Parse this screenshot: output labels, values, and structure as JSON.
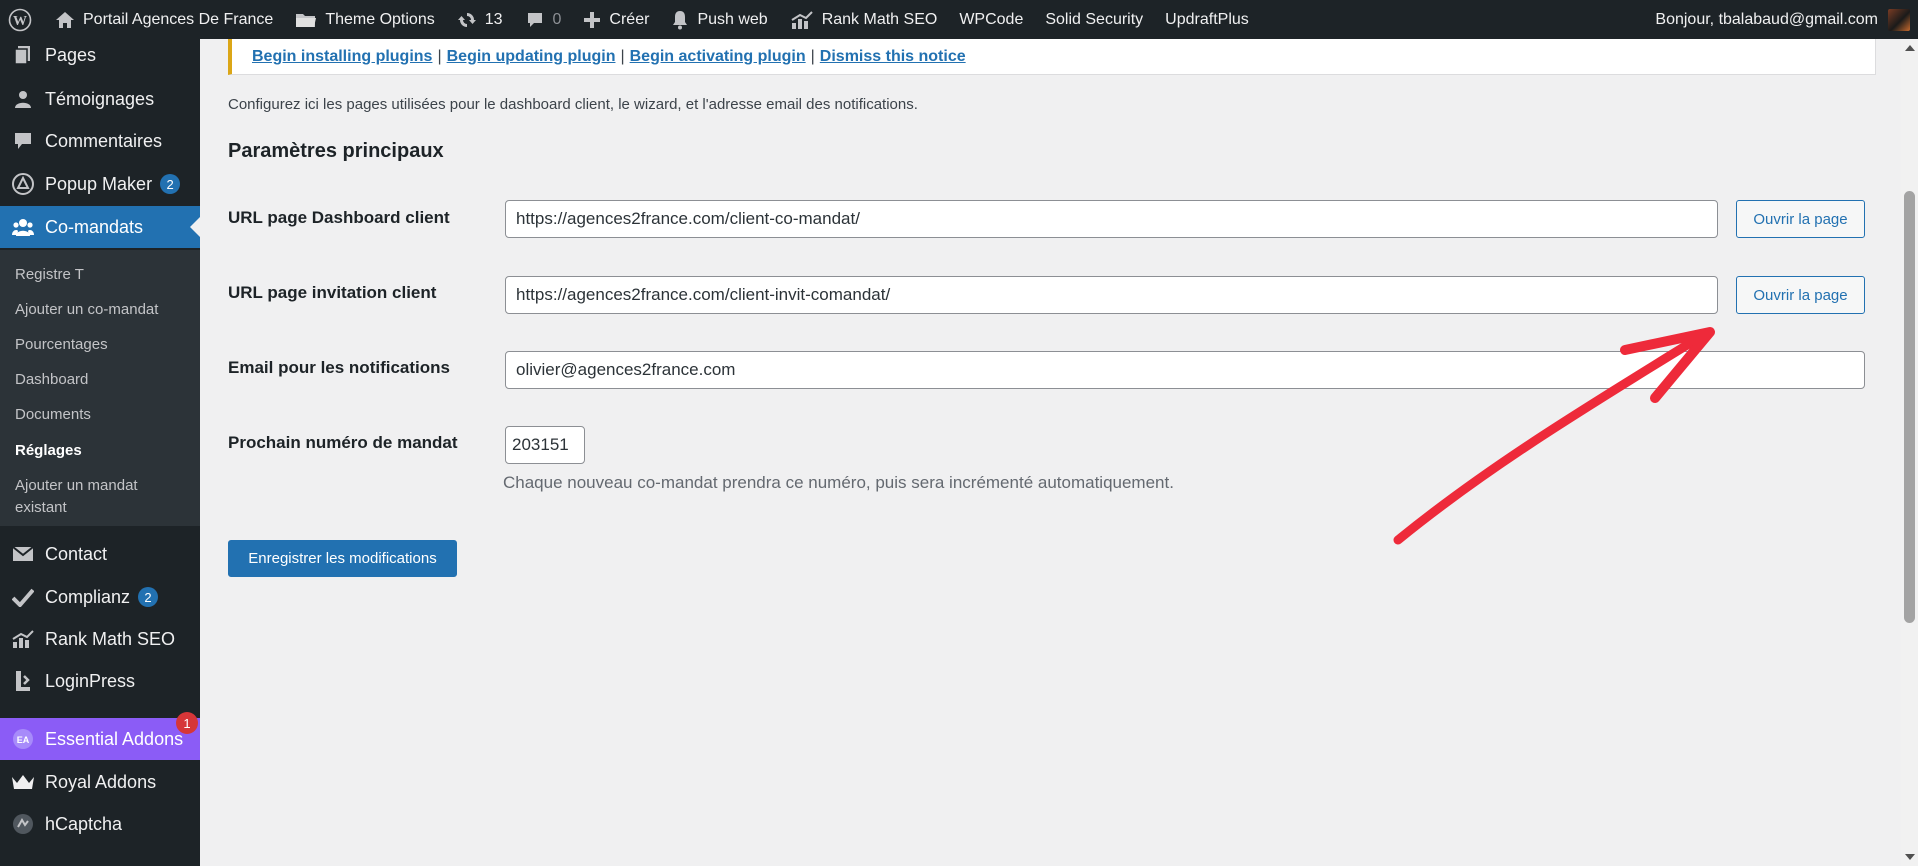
{
  "admin_bar": {
    "site_name": "Portail Agences De France",
    "theme_options": "Theme Options",
    "updates_count": "13",
    "comments_count": "0",
    "create": "Créer",
    "push_web": "Push web",
    "rank_math": "Rank Math SEO",
    "wpcode": "WPCode",
    "solid_security": "Solid Security",
    "updraftplus": "UpdraftPlus",
    "greeting": "Bonjour, tbalabaud@gmail.com"
  },
  "sidebar": {
    "pages": "Pages",
    "temoignages": "Témoignages",
    "commentaires": "Commentaires",
    "popup_maker": "Popup Maker",
    "popup_maker_badge": "2",
    "co_mandats": "Co-mandats",
    "submenu": {
      "registre": "Registre T",
      "ajouter": "Ajouter un co-mandat",
      "pourcentages": "Pourcentages",
      "dashboard": "Dashboard",
      "documents": "Documents",
      "reglages": "Réglages",
      "ajouter_existant_1": "Ajouter un mandat",
      "ajouter_existant_2": "existant"
    },
    "contact": "Contact",
    "complianz": "Complianz",
    "complianz_badge": "2",
    "rank_math": "Rank Math SEO",
    "loginpress": "LoginPress",
    "essential_addons": "Essential Addons",
    "essential_addons_badge": "1",
    "royal_addons": "Royal Addons",
    "hcaptcha": "hCaptcha"
  },
  "notice": {
    "install": "Begin installing plugins",
    "update": "Begin updating plugin",
    "activate": "Begin activating plugin",
    "dismiss": "Dismiss this notice",
    "separator": "|"
  },
  "main": {
    "intro": "Configurez ici les pages utilisées pour le dashboard client, le wizard, et l'adresse email des notifications.",
    "section_title": "Paramètres principaux",
    "dashboard_label": "URL page Dashboard client",
    "dashboard_value": "https://agences2france.com/client-co-mandat/",
    "invitation_label": "URL page invitation client",
    "invitation_value": "https://agences2france.com/client-invit-comandat/",
    "open_page": "Ouvrir la page",
    "email_label": "Email pour les notifications",
    "email_value": "olivier@agences2france.com",
    "mandat_label": "Prochain numéro de mandat",
    "mandat_value": "203151",
    "mandat_description": "Chaque nouveau co-mandat prendra ce numéro, puis sera incrémenté automatiquement.",
    "save": "Enregistrer les modifications"
  },
  "colors": {
    "accent": "#2271b1",
    "admin_dark": "#1d2327",
    "notice_warning": "#dba617",
    "essential_addons": "#8b5cf6",
    "annotation_arrow": "#ee2a3a"
  },
  "icons": [
    "wordpress-icon",
    "home-icon",
    "folder-icon",
    "updates-icon",
    "comment-icon",
    "plus-icon",
    "bell-icon",
    "rank-math-icon",
    "pages-icon",
    "user-icon",
    "comment-icon",
    "popup-icon",
    "groups-icon",
    "mail-icon",
    "check-icon",
    "loginpress-icon",
    "essential-addons-icon",
    "crown-icon",
    "hcaptcha-icon"
  ]
}
